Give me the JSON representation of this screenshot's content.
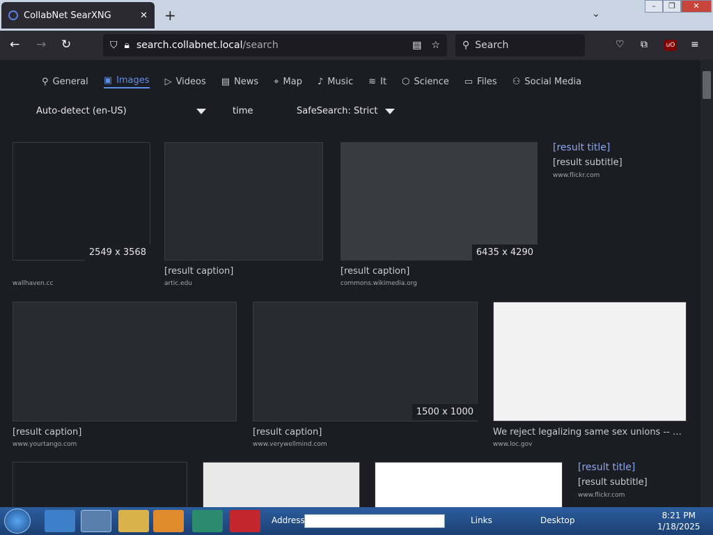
{
  "browser": {
    "tab_title": "CollabNet SearXNG",
    "url_host": "search.collabnet.local",
    "url_path": "/search",
    "search_placeholder": "Search"
  },
  "categories": [
    "General",
    "Images",
    "Videos",
    "News",
    "Map",
    "Music",
    "It",
    "Science",
    "Files",
    "Social Media"
  ],
  "active_category": "Images",
  "filters": {
    "language": "Auto-detect (en-US)",
    "time": "time",
    "safesearch": "SafeSearch: Strict"
  },
  "results": [
    {
      "resolution": "2549 x 3568",
      "caption": "",
      "domain": "wallhaven.cc"
    },
    {
      "resolution": "",
      "caption": "[result caption]",
      "domain": "artic.edu"
    },
    {
      "resolution": "6435 x 4290",
      "caption": "[result caption]",
      "domain": "commons.wikimedia.org"
    },
    {
      "resolution": "",
      "caption": "[result caption]",
      "domain": "www.yourtango.com"
    },
    {
      "resolution": "1500 x 1000",
      "caption": "[result caption]",
      "domain": "www.verywellmind.com"
    },
    {
      "resolution": "",
      "caption": "We reject legalizing same sex unions -- on th...",
      "domain": "www.loc.gov"
    }
  ],
  "side_results": [
    {
      "title": "[result title]",
      "subtitle": "[result subtitle]",
      "domain": "www.flickr.com"
    },
    {
      "title": "[result title]",
      "subtitle": "[result subtitle]",
      "domain": "www.flickr.com"
    }
  ],
  "taskbar": {
    "address_label": "Address",
    "links_label": "Links",
    "desktop_label": "Desktop",
    "time": "8:21 PM",
    "date": "1/18/2025"
  },
  "colors": {
    "accent": "#5b8fea",
    "page_bg": "#1c1d22"
  }
}
